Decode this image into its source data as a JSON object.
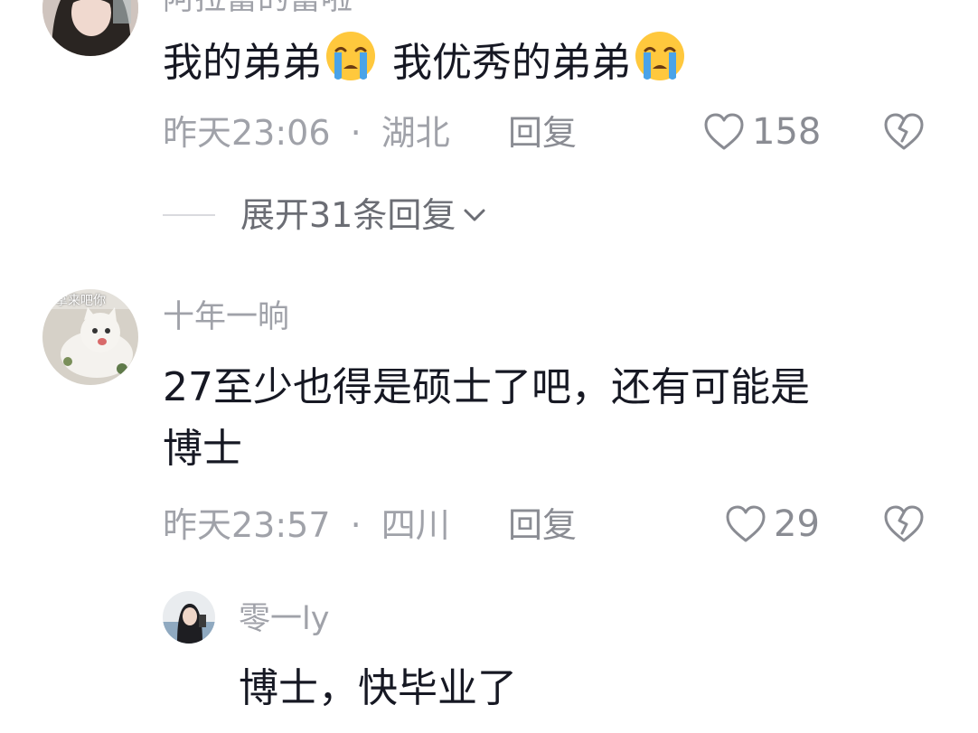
{
  "comments": [
    {
      "username": "阿拉蕾的蕾啦",
      "text_part1": "我的弟弟",
      "text_part2": " 我优秀的弟弟",
      "emoji": "loudly-crying-face",
      "time": "昨天23:06",
      "separator": "·",
      "location": "湖北",
      "reply_label": "回复",
      "likes": "158",
      "expand_label": "展开31条回复"
    },
    {
      "username": "十年一晌",
      "avatar_text": "拿来吧你",
      "text_line1": "27至少也得是硕士了吧，还有可能是",
      "text_line2": "博士",
      "time": "昨天23:57",
      "separator": "·",
      "location": "四川",
      "reply_label": "回复",
      "likes": "29"
    }
  ],
  "sub_reply": {
    "username": "零一ly",
    "text": "博士，快毕业了"
  },
  "colors": {
    "text_primary": "#161823",
    "text_secondary": "#a0a2a9",
    "icon_gray": "#8a8c93",
    "divider": "#d9dade"
  }
}
